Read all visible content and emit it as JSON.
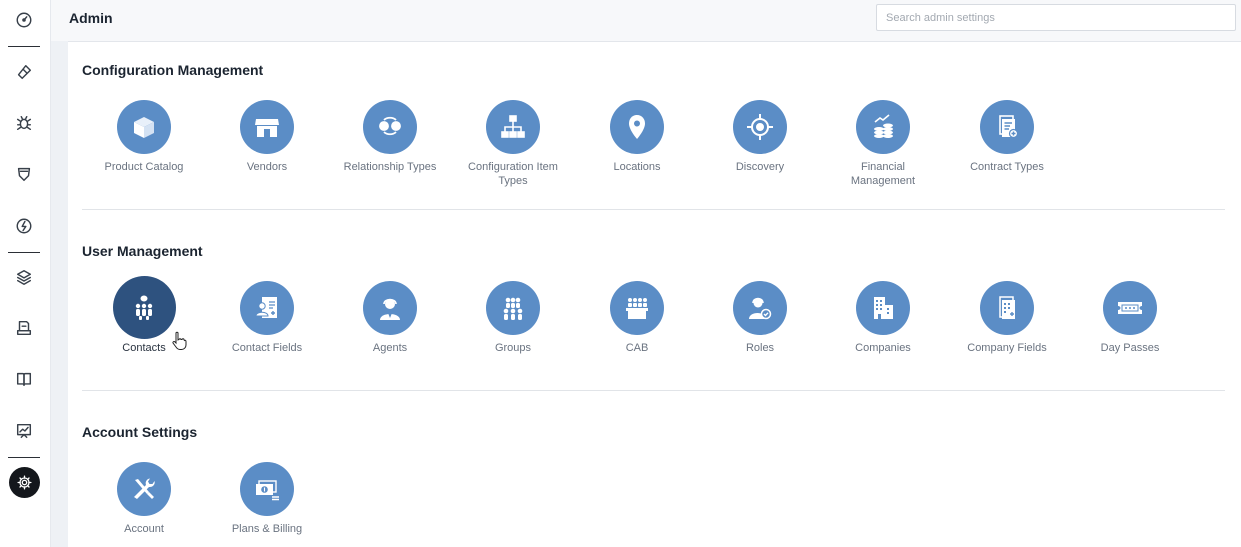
{
  "header": {
    "title": "Admin",
    "search_placeholder": "Search admin settings"
  },
  "rail": {
    "items": [
      {
        "icon": "dashboard-icon"
      },
      {
        "icon": "ticket-icon"
      },
      {
        "icon": "bug-icon"
      },
      {
        "icon": "shield-icon"
      },
      {
        "icon": "lightning-icon"
      },
      {
        "icon": "layers-icon"
      },
      {
        "icon": "inbox-icon"
      },
      {
        "icon": "book-icon"
      },
      {
        "icon": "reports-icon"
      },
      {
        "icon": "gear-icon",
        "active": true
      }
    ]
  },
  "sections": [
    {
      "title": "Configuration Management",
      "tiles": [
        {
          "label": "Product Catalog",
          "icon": "box-icon"
        },
        {
          "label": "Vendors",
          "icon": "store-icon"
        },
        {
          "label": "Relationship Types",
          "icon": "relationship-icon"
        },
        {
          "label": "Configuration Item Types",
          "icon": "hierarchy-icon"
        },
        {
          "label": "Locations",
          "icon": "location-pin-icon"
        },
        {
          "label": "Discovery",
          "icon": "crosshair-icon"
        },
        {
          "label": "Financial Management",
          "icon": "coins-chart-icon"
        },
        {
          "label": "Contract Types",
          "icon": "contract-icon"
        }
      ]
    },
    {
      "title": "User Management",
      "tiles": [
        {
          "label": "Contacts",
          "icon": "contacts-icon",
          "selected": true
        },
        {
          "label": "Contact Fields",
          "icon": "contact-card-icon"
        },
        {
          "label": "Agents",
          "icon": "agent-headset-icon"
        },
        {
          "label": "Groups",
          "icon": "group-icon"
        },
        {
          "label": "CAB",
          "icon": "cab-icon"
        },
        {
          "label": "Roles",
          "icon": "role-icon"
        },
        {
          "label": "Companies",
          "icon": "building-icon"
        },
        {
          "label": "Company Fields",
          "icon": "company-fields-icon"
        },
        {
          "label": "Day Passes",
          "icon": "ticket-pass-icon"
        }
      ]
    },
    {
      "title": "Account Settings",
      "tiles": [
        {
          "label": "Account",
          "icon": "tools-icon"
        },
        {
          "label": "Plans & Billing",
          "icon": "billing-icon"
        }
      ]
    }
  ],
  "colors": {
    "tile": "#5b8dc6",
    "tile_selected": "#2e527f",
    "rail_active": "#14171c"
  }
}
